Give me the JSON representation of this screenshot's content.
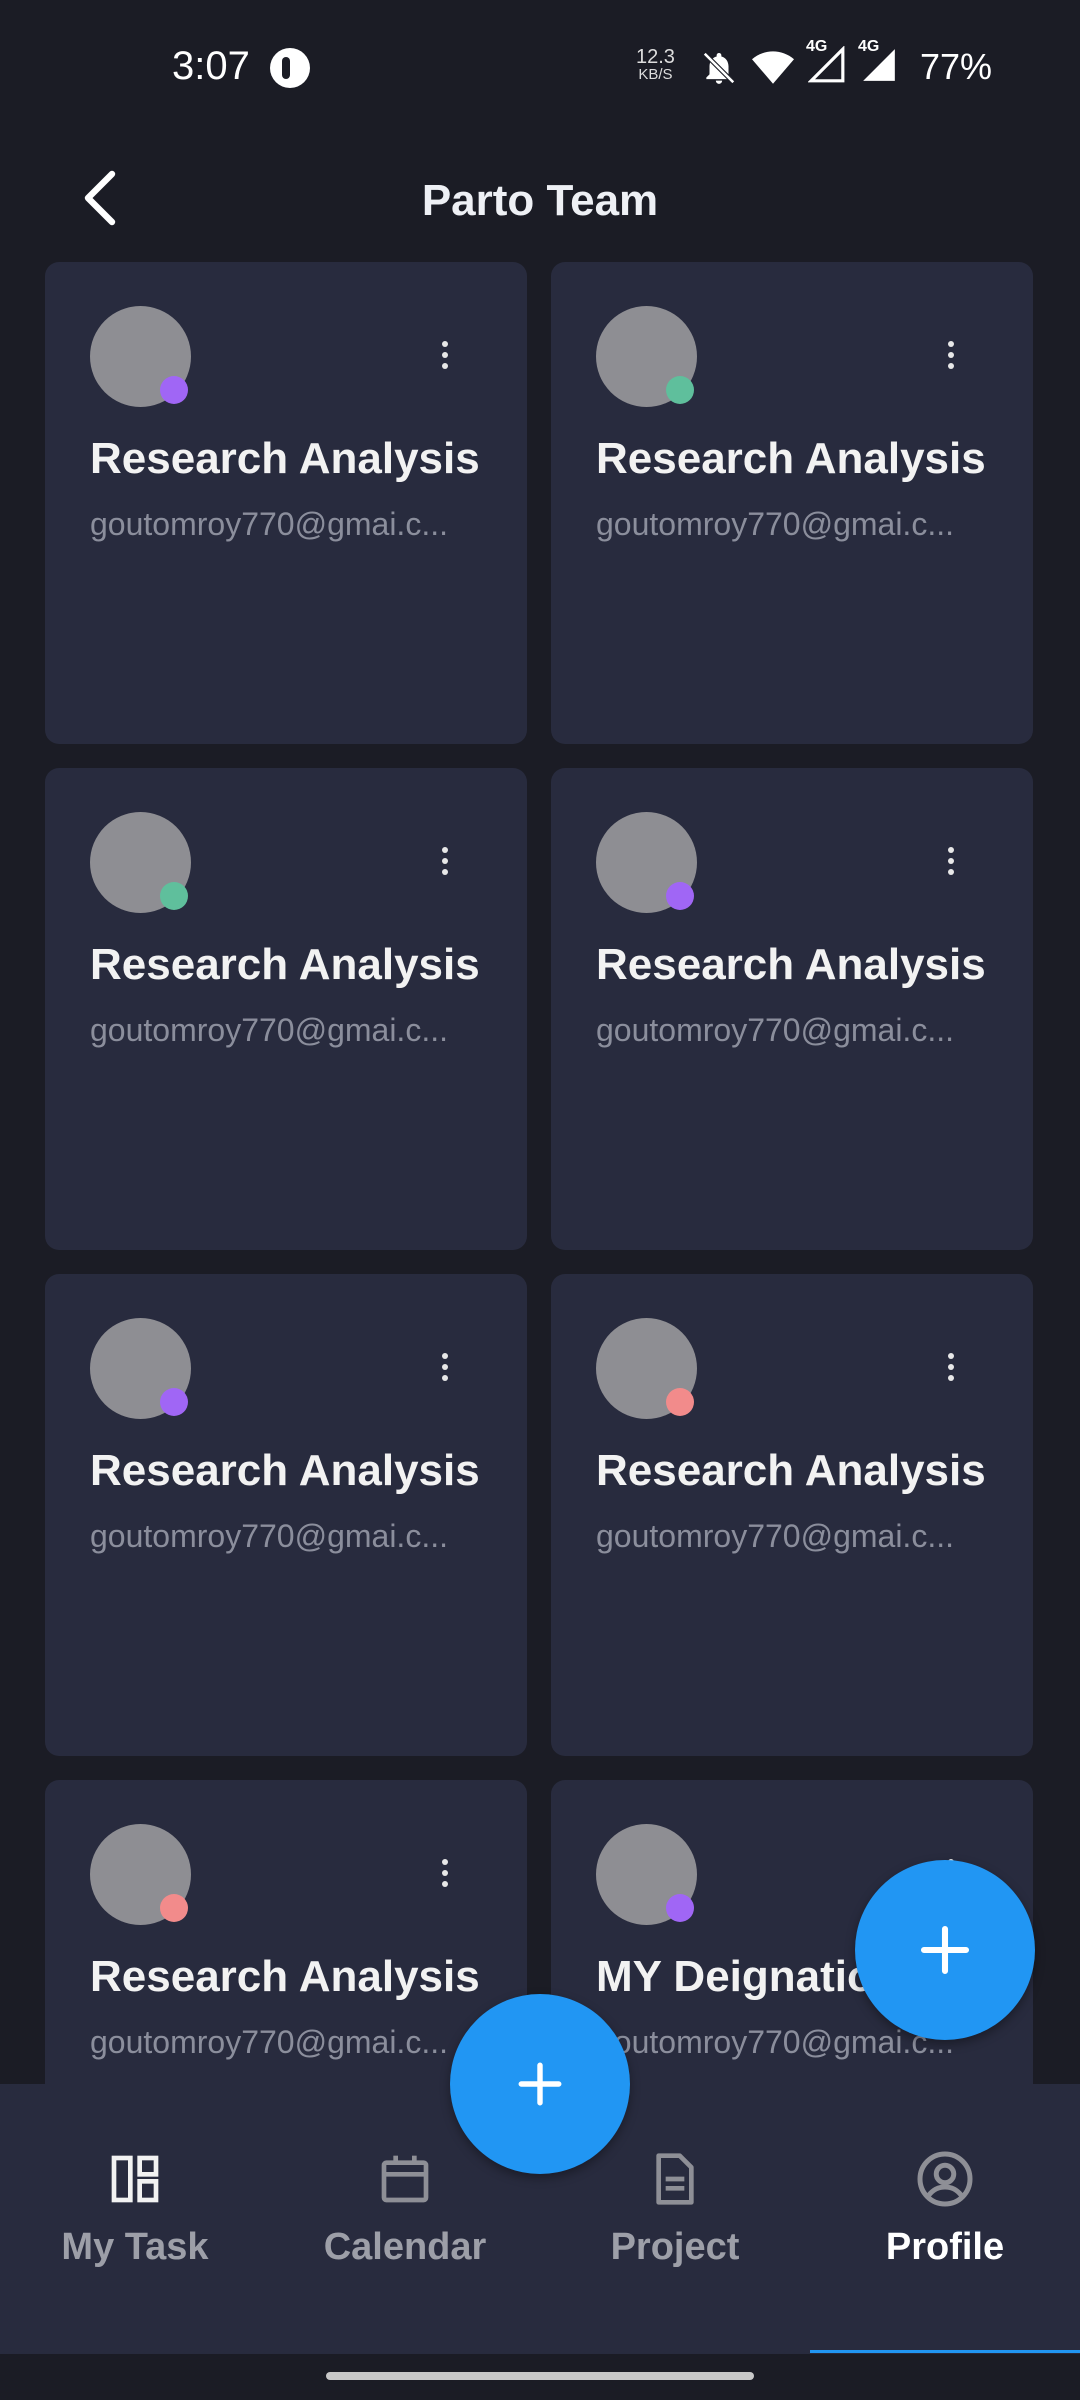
{
  "status_bar": {
    "time": "3:07",
    "net_speed_value": "12.3",
    "net_speed_unit": "KB/S",
    "network_label_1": "4G",
    "network_label_2": "4G",
    "battery": "77%"
  },
  "header": {
    "title": "Parto Team"
  },
  "members": [
    {
      "title": "Research Analysis",
      "email": "goutomroy770@gmai.c...",
      "status_color": "#a066f5"
    },
    {
      "title": "Research Analysis",
      "email": "goutomroy770@gmai.c...",
      "status_color": "#5fbf9c"
    },
    {
      "title": "Research Analysis",
      "email": "goutomroy770@gmai.c...",
      "status_color": "#5fbf9c"
    },
    {
      "title": "Research Analysis",
      "email": "goutomroy770@gmai.c...",
      "status_color": "#a066f5"
    },
    {
      "title": "Research Analysis",
      "email": "goutomroy770@gmai.c...",
      "status_color": "#a066f5"
    },
    {
      "title": "Research Analysis",
      "email": "goutomroy770@gmai.c...",
      "status_color": "#f28b8b"
    },
    {
      "title": "Research Analysis",
      "email": "goutomroy770@gmai.c...",
      "status_color": "#f28b8b"
    },
    {
      "title": "MY Deignation",
      "email": "goutomroy770@gmai.c...",
      "status_color": "#a066f5"
    }
  ],
  "nav": {
    "items": [
      {
        "label": "My Task",
        "icon": "dashboard-icon"
      },
      {
        "label": "Calendar",
        "icon": "calendar-icon"
      },
      {
        "label": "Project",
        "icon": "document-icon"
      },
      {
        "label": "Profile",
        "icon": "profile-icon"
      }
    ],
    "active": "Profile"
  },
  "colors": {
    "accent": "#2196f3",
    "background": "#1b1c25",
    "card": "#282b3e"
  }
}
